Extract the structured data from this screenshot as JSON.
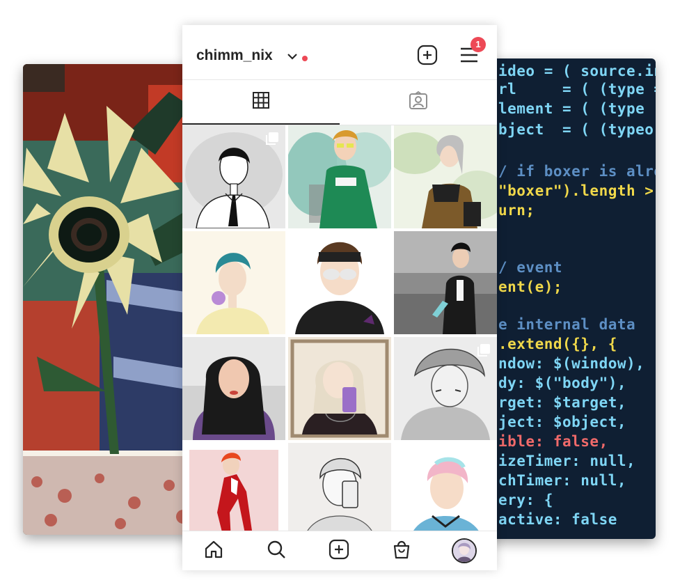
{
  "profile": {
    "username": "chimm_nix",
    "notification_count": "1"
  },
  "tabs": [
    {
      "name": "posts-grid",
      "icon": "grid-icon",
      "active": true
    },
    {
      "name": "tagged",
      "icon": "tagged-person-icon",
      "active": false
    }
  ],
  "posts": [
    {
      "alt": "drawing of boy in shirt and tie",
      "multiple": true
    },
    {
      "alt": "drawing of boy in green tee",
      "multiple": false
    },
    {
      "alt": "drawing of girl with silver hair",
      "multiple": false
    },
    {
      "alt": "drawing of boy with teal hair",
      "multiple": false
    },
    {
      "alt": "drawing of boy with headband and glasses",
      "multiple": false
    },
    {
      "alt": "drawing of boy in jacket",
      "multiple": false
    },
    {
      "alt": "drawing of girl with long dark hair",
      "multiple": false
    },
    {
      "alt": "drawing of girl taking mirror selfie",
      "multiple": false
    },
    {
      "alt": "pencil drawing of boy in bucket hat",
      "multiple": true
    },
    {
      "alt": "drawing of boy in red tracksuit",
      "multiple": false
    },
    {
      "alt": "pencil drawing of boy with phone",
      "multiple": false
    },
    {
      "alt": "drawing of boy with pastel hair",
      "multiple": false
    }
  ],
  "background_code": {
    "lines": [
      {
        "text": "ideo = ( source.in",
        "color": "#7fd6f5"
      },
      {
        "text": "rl     = ( (type =",
        "color": "#7fd6f5"
      },
      {
        "text": "lement = ( (type",
        "color": "#7fd6f5"
      },
      {
        "text": "bject  = ( (typeo",
        "color": "#7fd6f5"
      },
      {
        "text": "/ if boxer is alre",
        "color": "#5d8fc4"
      },
      {
        "text": "\"boxer\").length >",
        "color": "#f0d84a"
      },
      {
        "text": "urn;",
        "color": "#f0d84a"
      },
      {
        "text": "/ event",
        "color": "#5d8fc4"
      },
      {
        "text": "ent(e);",
        "color": "#f0d84a"
      },
      {
        "text": "e internal data",
        "color": "#5d8fc4"
      },
      {
        "text": ".extend({}, {",
        "color": "#f0d84a"
      },
      {
        "text": "ndow: $(window),",
        "color": "#7fd6f5"
      },
      {
        "text": "dy: $(\"body\"),",
        "color": "#7fd6f5"
      },
      {
        "text": "rget: $target,",
        "color": "#7fd6f5"
      },
      {
        "text": "ject: $object,",
        "color": "#7fd6f5"
      },
      {
        "text": "ible: false,",
        "color": "#f06a6a"
      },
      {
        "text": "izeTimer: null,",
        "color": "#7fd6f5"
      },
      {
        "text": "chTimer: null,",
        "color": "#7fd6f5"
      },
      {
        "text": "ery: {",
        "color": "#7fd6f5"
      },
      {
        "text": "active: false",
        "color": "#7fd6f5"
      }
    ]
  },
  "colors": {
    "accent_red": "#ed4956",
    "icon": "#262626",
    "divider": "#e6e6e6"
  },
  "nav": [
    "home-icon",
    "search-icon",
    "add-post-icon",
    "shop-icon",
    "profile-avatar"
  ]
}
